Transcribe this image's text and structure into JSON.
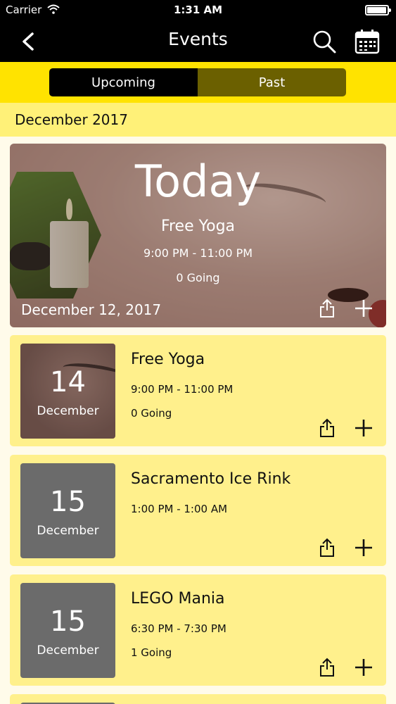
{
  "status_bar": {
    "carrier": "Carrier",
    "time": "1:31 AM",
    "battery_level": 0.9
  },
  "nav": {
    "title": "Events"
  },
  "segments": {
    "upcoming": "Upcoming",
    "past": "Past",
    "selected": "Upcoming"
  },
  "section": {
    "month": "December 2017"
  },
  "today": {
    "heading": "Today",
    "name": "Free Yoga",
    "time": "9:00 PM - 11:00 PM",
    "going": "0 Going",
    "date": "December 12, 2017"
  },
  "events": [
    {
      "day": "14",
      "month": "December",
      "name": "Free Yoga",
      "time": "9:00 PM - 11:00 PM",
      "going": "0 Going",
      "photo": true
    },
    {
      "day": "15",
      "month": "December",
      "name": "Sacramento Ice Rink",
      "time": "1:00 PM - 1:00 AM",
      "going": "",
      "photo": false
    },
    {
      "day": "15",
      "month": "December",
      "name": "LEGO Mania",
      "time": "6:30 PM - 7:30 PM",
      "going": "1 Going",
      "photo": false
    }
  ],
  "colors": {
    "accent": "#ffe300",
    "card": "#fff08c",
    "month_bar": "#fff178",
    "segment_inactive": "#6b6000",
    "date_box": "#6b6b6b"
  },
  "icons": [
    "wifi-icon",
    "battery-icon",
    "back-chevron-icon",
    "search-icon",
    "calendar-icon",
    "share-icon",
    "plus-icon"
  ]
}
